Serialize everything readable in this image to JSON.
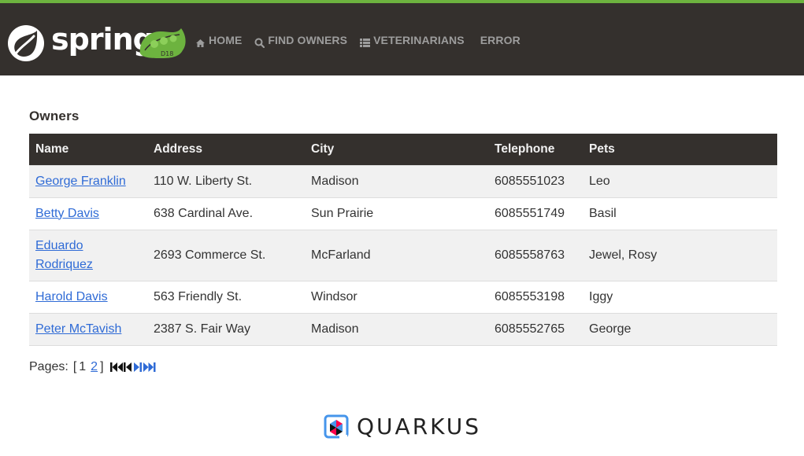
{
  "brand": {
    "wordmark": "spring",
    "badge_text": "D18"
  },
  "nav": {
    "items": [
      {
        "label": "HOME",
        "icon": "home-icon"
      },
      {
        "label": "FIND OWNERS",
        "icon": "search-icon"
      },
      {
        "label": "VETERINARIANS",
        "icon": "list-icon"
      },
      {
        "label": "ERROR",
        "icon": ""
      }
    ]
  },
  "owners": {
    "title": "Owners",
    "columns": [
      "Name",
      "Address",
      "City",
      "Telephone",
      "Pets"
    ],
    "rows": [
      {
        "name": "George Franklin",
        "address": "110 W. Liberty St.",
        "city": "Madison",
        "telephone": "6085551023",
        "pets": "Leo"
      },
      {
        "name": "Betty Davis",
        "address": "638 Cardinal Ave.",
        "city": "Sun Prairie",
        "telephone": "6085551749",
        "pets": "Basil"
      },
      {
        "name_line1": "Eduardo",
        "name_line2": "Rodriquez",
        "address": "2693 Commerce St.",
        "city": "McFarland",
        "telephone": "6085558763",
        "pets": "Jewel, Rosy"
      },
      {
        "name": "Harold Davis",
        "address": "563 Friendly St.",
        "city": "Windsor",
        "telephone": "6085553198",
        "pets": "Iggy"
      },
      {
        "name": "Peter McTavish",
        "address": "2387 S. Fair Way",
        "city": "Madison",
        "telephone": "6085552765",
        "pets": "George"
      }
    ]
  },
  "pagination": {
    "label": "Pages:",
    "open_bracket": "[",
    "current_page": "1",
    "other_page": "2",
    "close_bracket": "]",
    "controls": [
      "first-page-icon",
      "previous-page-icon",
      "next-page-icon",
      "last-page-icon"
    ]
  },
  "footer": {
    "logo_text": "QUARKUS"
  },
  "colors": {
    "navbar": "#34302d",
    "accent_green": "#6db33f",
    "link": "#2f6bd6",
    "row_stripe": "#f1f1f1"
  }
}
